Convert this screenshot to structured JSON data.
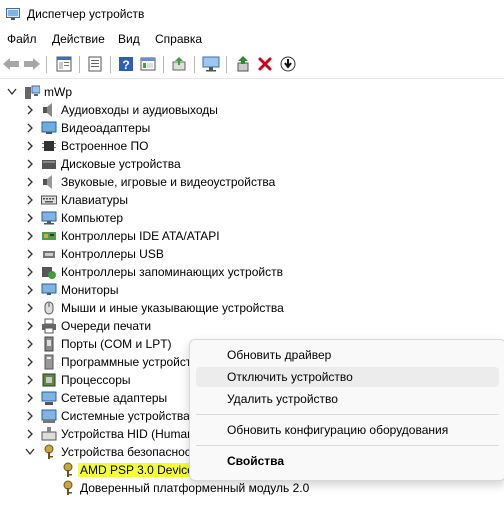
{
  "window": {
    "title": "Диспетчер устройств"
  },
  "menubar": {
    "items": [
      "Файл",
      "Действие",
      "Вид",
      "Справка"
    ]
  },
  "toolbar": {
    "buttons": [
      "back-icon",
      "forward-icon",
      "properties-icon",
      "device-list-icon",
      "help-icon",
      "view-icon",
      "update-driver-icon",
      "scan-hardware-icon",
      "enable-device-icon",
      "uninstall-device-icon",
      "download-driver-icon"
    ]
  },
  "tree": {
    "root": "mWp",
    "categories": [
      "Аудиовходы и аудиовыходы",
      "Видеоадаптеры",
      "Встроенное ПО",
      "Дисковые устройства",
      "Звуковые, игровые и видеоустройства",
      "Клавиатуры",
      "Компьютер",
      "Контроллеры IDE ATA/ATAPI",
      "Контроллеры USB",
      "Контроллеры запоминающих устройств",
      "Мониторы",
      "Мыши и иные указывающие устройства",
      "Очереди печати",
      "Порты (COM и LPT)",
      "Программные устройства",
      "Процессоры",
      "Сетевые адаптеры",
      "Системные устройства",
      "Устройства HID (Human Interface Devices)",
      "Устройства безопасности"
    ],
    "security_children": [
      "AMD PSP 3.0 Device",
      "Доверенный платформенный модуль 2.0"
    ]
  },
  "context_menu": {
    "items": [
      "Обновить драйвер",
      "Отключить устройство",
      "Удалить устройство",
      "Обновить конфигурацию оборудования",
      "Свойства"
    ]
  },
  "colors": {
    "highlight": "#f4ff3a",
    "menu_bg": "#f9f9f9"
  }
}
